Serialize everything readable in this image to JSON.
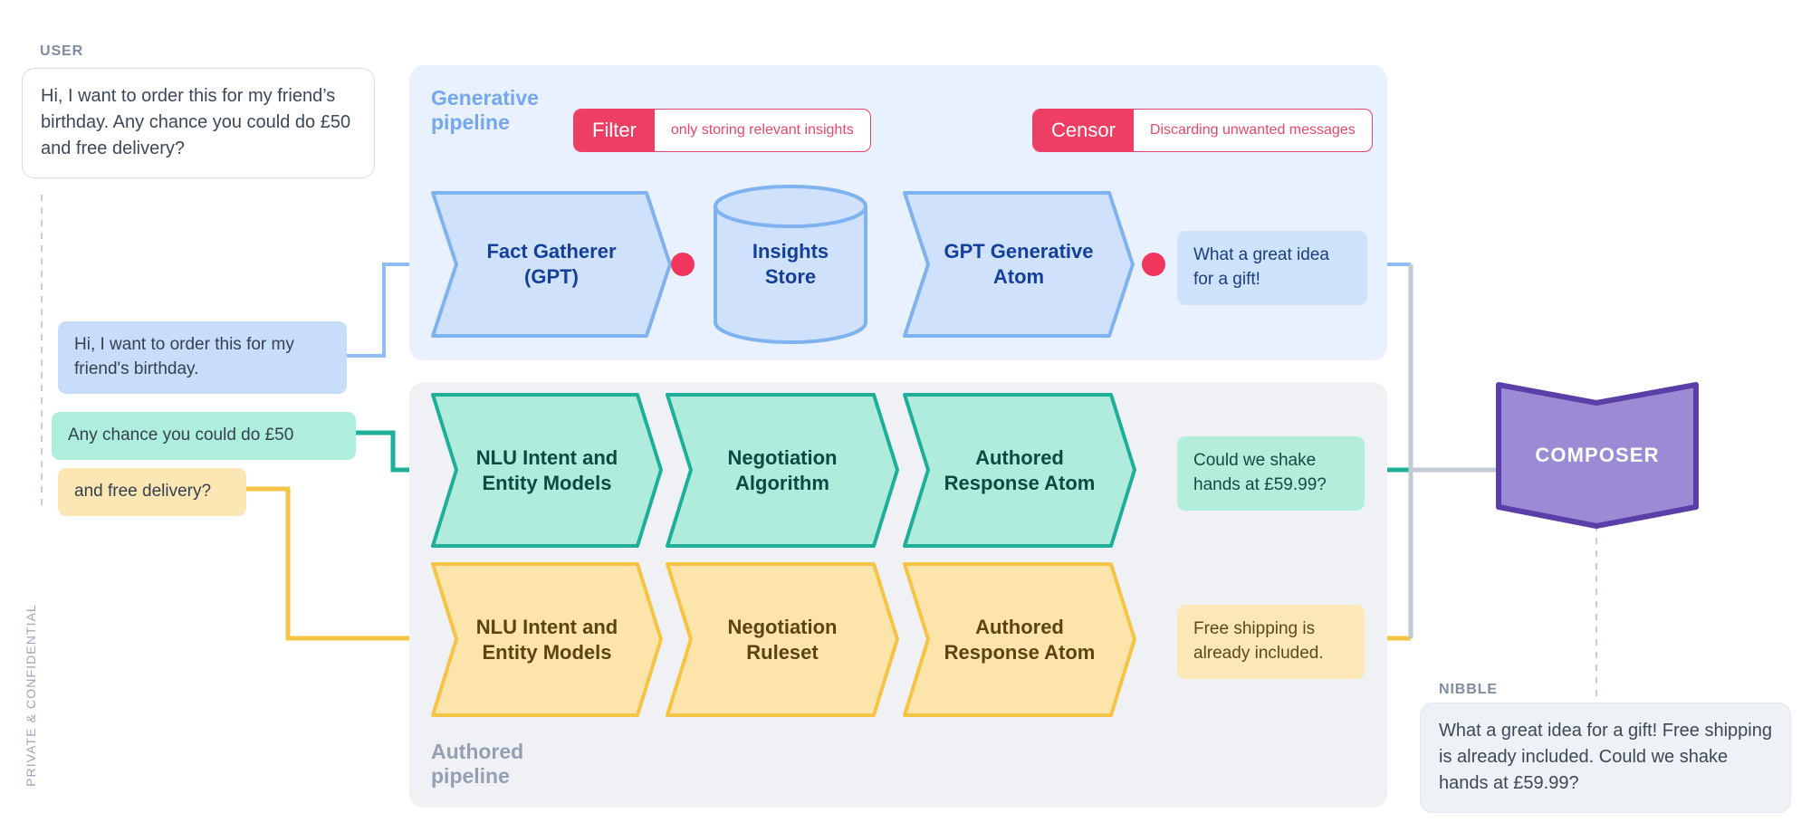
{
  "meta": {
    "confidential_note": "PRIVATE & CONFIDENTIAL",
    "colors": {
      "generative_panel": "#e9f1fe",
      "authored_panel": "#eff1f5",
      "blue_node": "#cfe1fb",
      "blue_stroke": "#7fb2f0",
      "teal_node": "#b0ecdc",
      "teal_stroke": "#1fae99",
      "yellow_node": "#fce4ab",
      "yellow_stroke": "#f7c council",
      "yellow_stroke_hex": "#f6c445",
      "composer_fill": "#9b8bd4",
      "composer_stroke": "#5b3fa8",
      "badge_red": "#ef3e63",
      "connector_gray": "#c0c9d4"
    }
  },
  "user": {
    "label": "USER",
    "message": "Hi, I want to order this for my friend’s birthday. Any chance you could do £50 and free delivery?"
  },
  "nibble": {
    "label": "NIBBLE",
    "message": "What a great idea for a gift! Free shipping is already included. Could we shake hands at £59.99?"
  },
  "input_chips": [
    {
      "id": "chip-generative",
      "text": "Hi, I want to order this for my friend's birthday.",
      "color": "blue"
    },
    {
      "id": "chip-negotiation",
      "text": "Any chance you could do £50",
      "color": "teal"
    },
    {
      "id": "chip-delivery",
      "text": "and free delivery?",
      "color": "yellow"
    }
  ],
  "generative_pipeline": {
    "title": "Generative\npipeline",
    "badges": [
      {
        "key": "Filter",
        "value": "only storing relevant insights"
      },
      {
        "key": "Censor",
        "value": "Discarding unwanted messages"
      }
    ],
    "nodes": [
      {
        "type": "chevron",
        "lines": [
          "Fact Gatherer",
          "(GPT)"
        ]
      },
      {
        "type": "cylinder",
        "lines": [
          "Insights",
          "Store"
        ]
      },
      {
        "type": "chevron",
        "lines": [
          "GPT Generative",
          "Atom"
        ]
      }
    ],
    "output": "What a great idea for a gift!"
  },
  "authored_pipeline": {
    "title": "Authored\npipeline",
    "rows": [
      {
        "id": "negotiation-row",
        "color": "teal",
        "nodes": [
          {
            "lines": [
              "NLU Intent and",
              "Entity Models"
            ]
          },
          {
            "lines": [
              "Negotiation",
              "Algorithm"
            ]
          },
          {
            "lines": [
              "Authored",
              "Response Atom"
            ]
          }
        ],
        "output": "Could we shake hands at £59.99?"
      },
      {
        "id": "delivery-row",
        "color": "yellow",
        "nodes": [
          {
            "lines": [
              "NLU Intent and",
              "Entity Models"
            ]
          },
          {
            "lines": [
              "Negotiation",
              "Ruleset"
            ]
          },
          {
            "lines": [
              "Authored",
              "Response Atom"
            ]
          }
        ],
        "output": "Free shipping is already included."
      }
    ]
  },
  "composer": {
    "label": "COMPOSER"
  }
}
